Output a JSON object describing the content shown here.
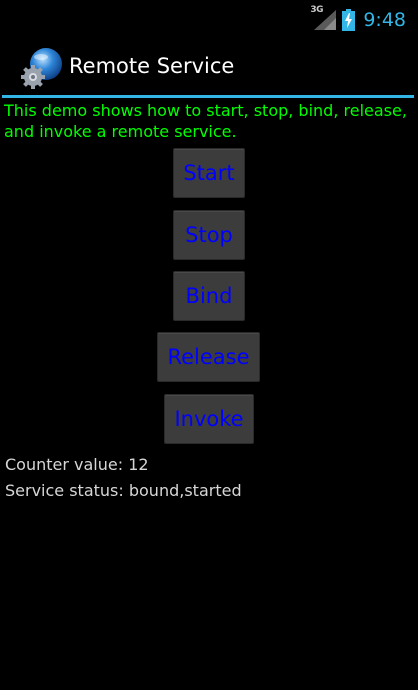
{
  "status_bar": {
    "network_type": "3G",
    "clock": "9:48",
    "icons": [
      "signal-icon",
      "battery-charging-icon"
    ],
    "clock_color": "#33b5e5"
  },
  "title_bar": {
    "title": "Remote Service",
    "icon": "app-globe-gear-icon",
    "divider_color": "#33b5e5"
  },
  "main": {
    "description": "This demo shows how to start, stop, bind, release, and invoke a remote service.",
    "description_color": "#00ff00",
    "buttons": {
      "start": "Start",
      "stop": "Stop",
      "bind": "Bind",
      "release": "Release",
      "invoke": "Invoke"
    },
    "button_text_color": "#0000ff",
    "counter": {
      "label": "Counter value: ",
      "value": "12"
    },
    "service_status": {
      "label": "Service status: ",
      "value": "bound,started"
    }
  }
}
